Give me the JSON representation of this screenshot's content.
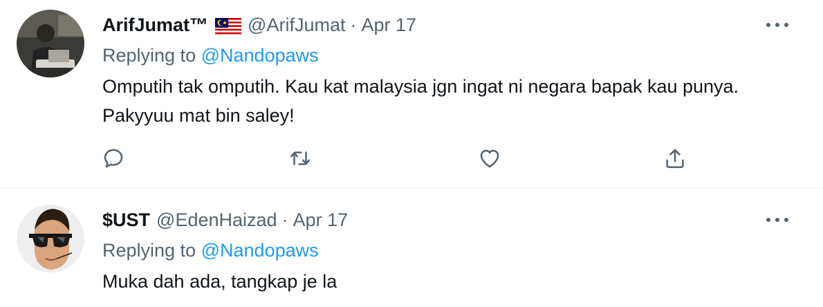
{
  "tweets": [
    {
      "display_name": "ArifJumat™",
      "flag_icon": "malaysia-flag-icon",
      "handle": "@ArifJumat",
      "separator": "·",
      "date": "Apr 17",
      "replying_prefix": "Replying to",
      "replying_to": "@Nandopaws",
      "text": "Omputih tak omputih. Kau kat malaysia jgn ingat ni negara bapak kau punya. Pakyyuu mat bin saley!",
      "actions": [
        "reply-icon",
        "retweet-icon",
        "like-icon",
        "share-icon"
      ]
    },
    {
      "display_name": "$UST",
      "handle": "@EdenHaizad",
      "separator": "·",
      "date": "Apr 17",
      "replying_prefix": "Replying to",
      "replying_to": "@Nandopaws",
      "text": "Muka dah ada, tangkap je la"
    }
  ],
  "colors": {
    "text": "#0f1419",
    "secondary": "#536471",
    "accent": "#1d9bf0",
    "divider": "#eff3f4"
  }
}
